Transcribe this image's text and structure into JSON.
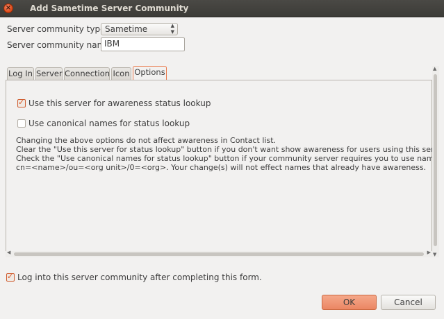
{
  "window": {
    "title": "Add Sametime Server Community",
    "close_glyph": "×"
  },
  "form": {
    "type_label": "Server community type:",
    "type_value": "Sametime",
    "name_label": "Server community name:",
    "name_value": "IBM"
  },
  "tabs": [
    {
      "label": "Log In",
      "active": false
    },
    {
      "label": "Server",
      "active": false
    },
    {
      "label": "Connection",
      "active": false
    },
    {
      "label": "Icon",
      "active": false
    },
    {
      "label": "Options",
      "active": true
    }
  ],
  "options": {
    "awareness_label": "Use this server for awareness status lookup",
    "awareness_checked": true,
    "canonical_label": "Use canonical names for status lookup",
    "canonical_checked": false,
    "description": [
      "Changing the above options do not affect awareness in Contact list.",
      "Clear the \"Use this server for status lookup\" button if you don't want show awareness for users using this server.",
      "Check the \"Use canonical names for status lookup\" button if your community server requires you to use name in the form",
      " cn=<name>/ou=<org unit>/0=<org>. Your change(s) will not effect names that already have awareness."
    ]
  },
  "login_after": {
    "label": "Log into this server community after completing this form.",
    "checked": true
  },
  "buttons": {
    "ok": "OK",
    "cancel": "Cancel"
  },
  "colors": {
    "accent": "#e9784a",
    "titlebar": "#3c3b37",
    "window_bg": "#f2f1f0"
  },
  "icons": {
    "close": "close-icon",
    "check": "check-icon",
    "combo_arrows": "updown-arrows-icon"
  }
}
